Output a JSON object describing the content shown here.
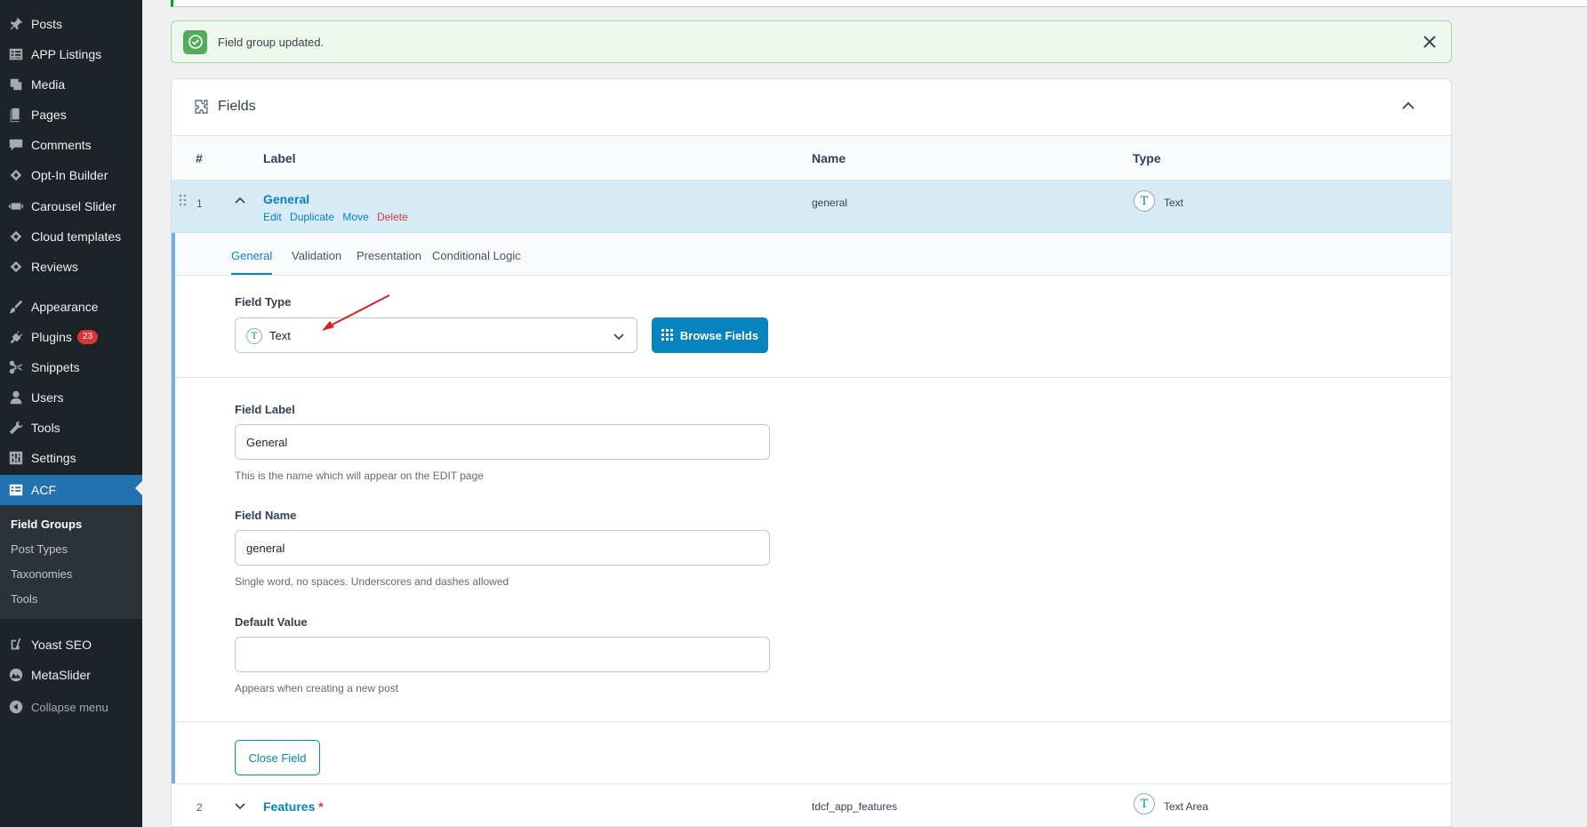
{
  "sidebar": {
    "items": [
      {
        "label": "Posts",
        "icon": "pin-icon"
      },
      {
        "label": "APP Listings",
        "icon": "table-icon"
      },
      {
        "label": "Media",
        "icon": "media-icon"
      },
      {
        "label": "Pages",
        "icon": "page-icon"
      },
      {
        "label": "Comments",
        "icon": "comment-icon"
      },
      {
        "label": "Opt-In Builder",
        "icon": "diamond-icon"
      },
      {
        "label": "Carousel Slider",
        "icon": "slider-icon"
      },
      {
        "label": "Cloud templates",
        "icon": "diamond-icon"
      },
      {
        "label": "Reviews",
        "icon": "diamond-icon"
      },
      {
        "label": "Appearance",
        "icon": "brush-icon"
      },
      {
        "label": "Plugins",
        "icon": "plugin-icon",
        "badge": "23"
      },
      {
        "label": "Snippets",
        "icon": "scissors-icon"
      },
      {
        "label": "Users",
        "icon": "user-icon"
      },
      {
        "label": "Tools",
        "icon": "wrench-icon"
      },
      {
        "label": "Settings",
        "icon": "settings-icon"
      },
      {
        "label": "ACF",
        "icon": "acf-icon",
        "active": true
      }
    ],
    "submenu": [
      "Field Groups",
      "Post Types",
      "Taxonomies",
      "Tools"
    ],
    "bottom_items": [
      {
        "label": "Yoast SEO",
        "icon": "yoast-icon"
      },
      {
        "label": "MetaSlider",
        "icon": "metaslider-icon"
      }
    ],
    "collapse_label": "Collapse menu"
  },
  "notice": {
    "message": "Field group updated."
  },
  "card": {
    "title": "Fields"
  },
  "table": {
    "headers": {
      "num": "#",
      "label": "Label",
      "name": "Name",
      "type": "Type"
    }
  },
  "field1": {
    "number": "1",
    "label": "General",
    "actions": {
      "edit": "Edit",
      "duplicate": "Duplicate",
      "move": "Move",
      "delete": "Delete"
    },
    "name": "general",
    "type_icon": "T",
    "type": "Text"
  },
  "tabs": [
    "General",
    "Validation",
    "Presentation",
    "Conditional Logic"
  ],
  "form": {
    "field_type_label": "Field Type",
    "field_type_value": "Text",
    "field_type_icon": "T",
    "browse_label": "Browse Fields",
    "field_label_label": "Field Label",
    "field_label_value": "General",
    "field_label_help": "This is the name which will appear on the EDIT page",
    "field_name_label": "Field Name",
    "field_name_value": "general",
    "field_name_help": "Single word, no spaces. Underscores and dashes allowed",
    "default_value_label": "Default Value",
    "default_value_value": "",
    "default_value_help": "Appears when creating a new post",
    "close_label": "Close Field"
  },
  "field2": {
    "number": "2",
    "label": "Features",
    "required_mark": "*",
    "name": "tdcf_app_features",
    "type_icon": "T",
    "type": "Text Area"
  },
  "colors": {
    "sidebar_bg": "#1d2327",
    "accent": "#2271b1",
    "acf_blue": "#0783be",
    "success": "#52ac5c",
    "danger": "#d63638",
    "arrow": "#e02020"
  }
}
